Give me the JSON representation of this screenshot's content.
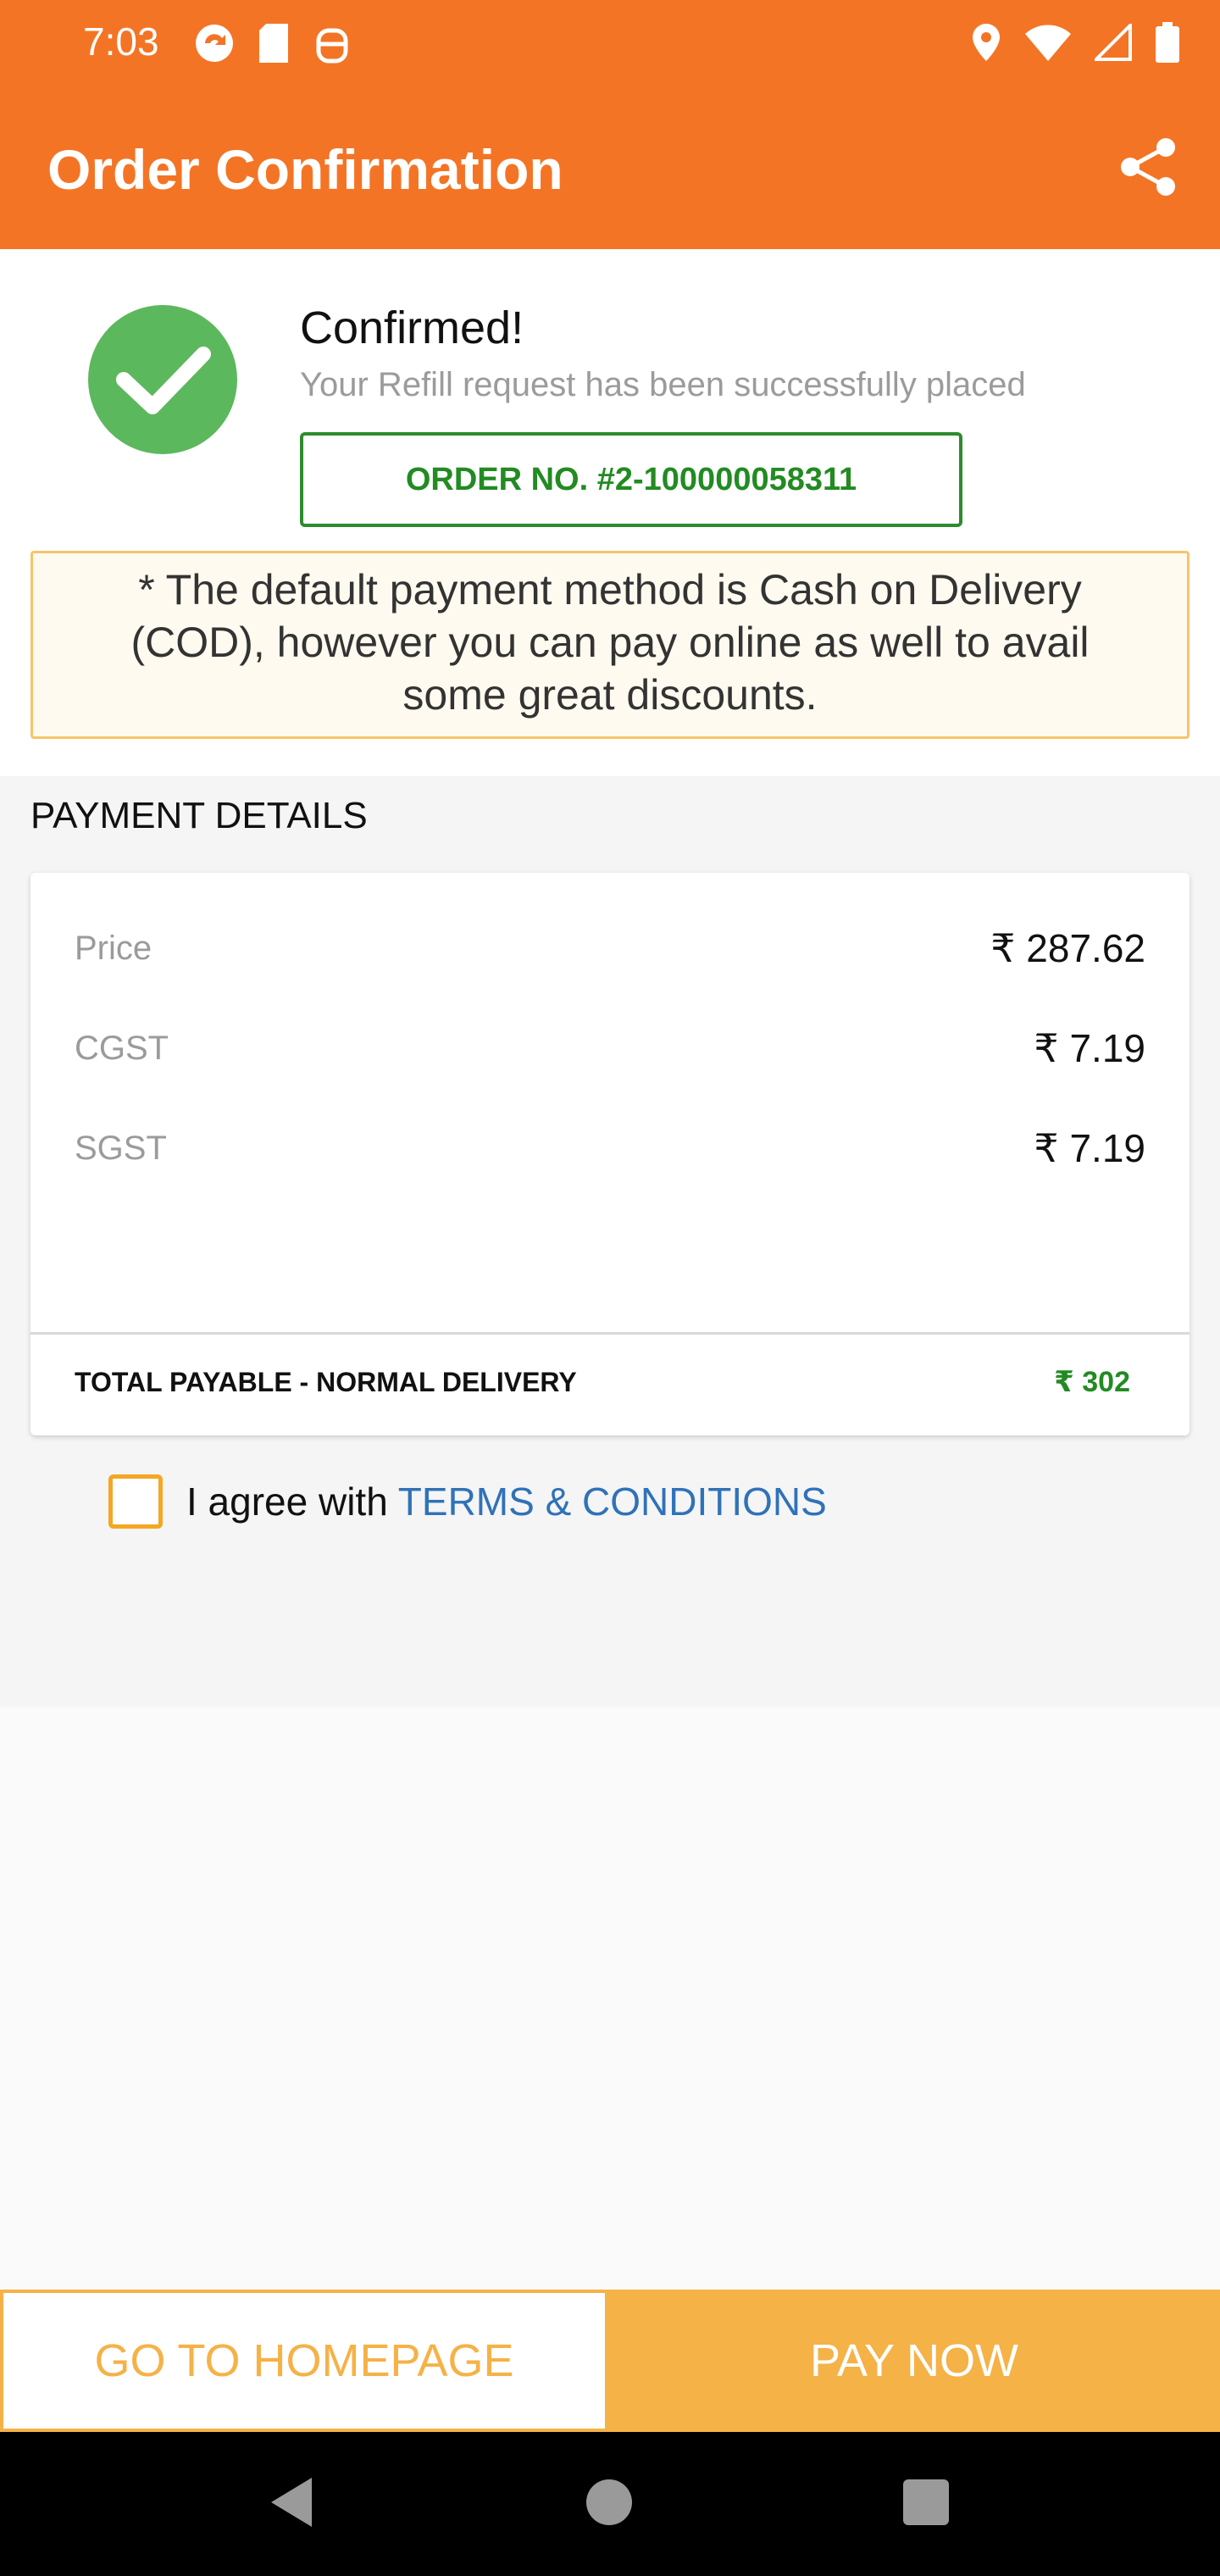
{
  "status_bar": {
    "time": "7:03",
    "left_icons": [
      "sync-icon",
      "sd-card-icon",
      "android-debug-icon"
    ],
    "right_icons": [
      "location-icon",
      "wifi-icon",
      "signal-icon",
      "battery-icon"
    ]
  },
  "app_bar": {
    "title": "Order Confirmation",
    "share_icon": "share-icon"
  },
  "confirmation": {
    "title": "Confirmed!",
    "subtitle": "Your Refill request has been successfully placed",
    "order_number": "ORDER NO. #2-100000058311",
    "notice": "* The default payment method is Cash on Delivery (COD), however you can pay online as well to avail some great discounts."
  },
  "payment": {
    "heading": "PAYMENT DETAILS",
    "rows": [
      {
        "label": "Price",
        "value": "₹ 287.62"
      },
      {
        "label": "CGST",
        "value": "₹ 7.19"
      },
      {
        "label": "SGST",
        "value": "₹ 7.19"
      }
    ],
    "total_label": "TOTAL PAYABLE - NORMAL DELIVERY",
    "total_value": "₹ 302"
  },
  "terms": {
    "prefix": "I agree with",
    "link": "TERMS & CONDITIONS",
    "checked": false
  },
  "buttons": {
    "home": "GO TO HOMEPAGE",
    "pay": "PAY NOW"
  },
  "colors": {
    "header": "#f47425",
    "success": "#5cb85c",
    "accent": "#f5b247",
    "link": "#2f72b8"
  }
}
